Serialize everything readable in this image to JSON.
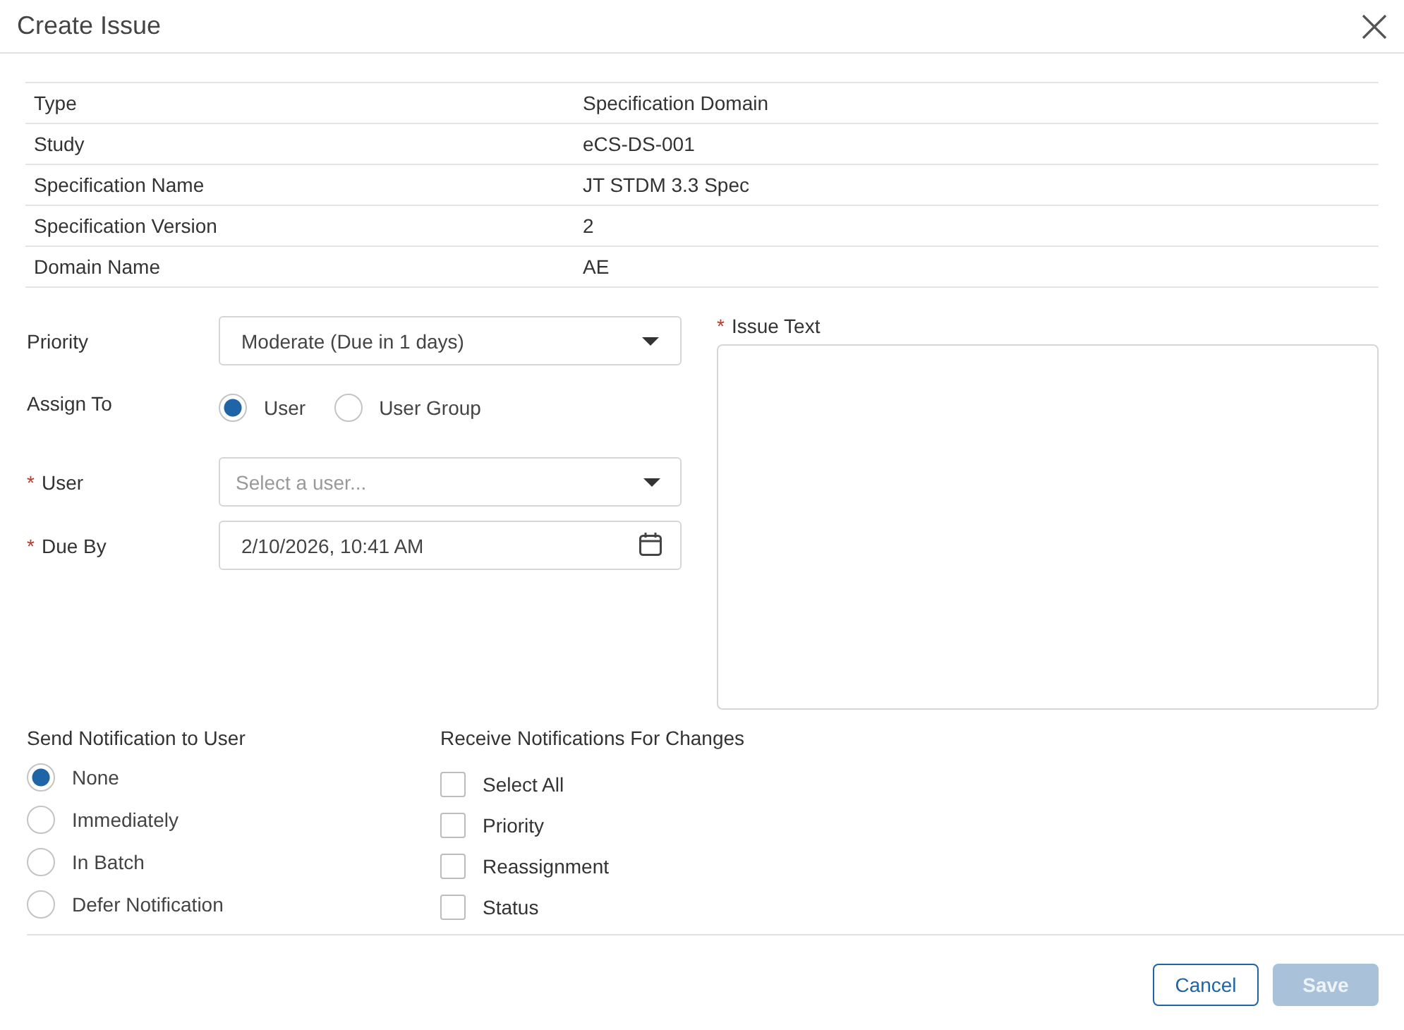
{
  "dialog": {
    "title": "Create Issue"
  },
  "details": [
    {
      "label": "Type",
      "value": "Specification Domain"
    },
    {
      "label": "Study",
      "value": "eCS-DS-001"
    },
    {
      "label": "Specification Name",
      "value": "JT STDM 3.3 Spec"
    },
    {
      "label": "Specification Version",
      "value": "2"
    },
    {
      "label": "Domain Name",
      "value": "AE"
    }
  ],
  "form": {
    "priority": {
      "label": "Priority",
      "value": "Moderate (Due in 1 days)"
    },
    "assign_to": {
      "label": "Assign To",
      "options": [
        {
          "label": "User",
          "selected": true
        },
        {
          "label": "User Group",
          "selected": false
        }
      ]
    },
    "user": {
      "label": "User",
      "required_mark": "*",
      "placeholder": "Select a user..."
    },
    "due_by": {
      "label": "Due By",
      "required_mark": "*",
      "value": "2/10/2026, 10:41 AM"
    },
    "issue_text": {
      "label": "Issue Text",
      "required_mark": "*"
    }
  },
  "send_notification": {
    "title": "Send Notification to User",
    "options": [
      {
        "label": "None",
        "selected": true
      },
      {
        "label": "Immediately",
        "selected": false
      },
      {
        "label": "In Batch",
        "selected": false
      },
      {
        "label": "Defer Notification",
        "selected": false
      }
    ]
  },
  "receive_notifications": {
    "title": "Receive Notifications For Changes",
    "options": [
      {
        "label": "Select All",
        "checked": false
      },
      {
        "label": "Priority",
        "checked": false
      },
      {
        "label": "Reassignment",
        "checked": false
      },
      {
        "label": "Status",
        "checked": false
      }
    ]
  },
  "buttons": [
    {
      "label": "Cancel",
      "kind": "secondary",
      "disabled": false
    },
    {
      "label": "Save",
      "kind": "primary",
      "disabled": true
    }
  ]
}
